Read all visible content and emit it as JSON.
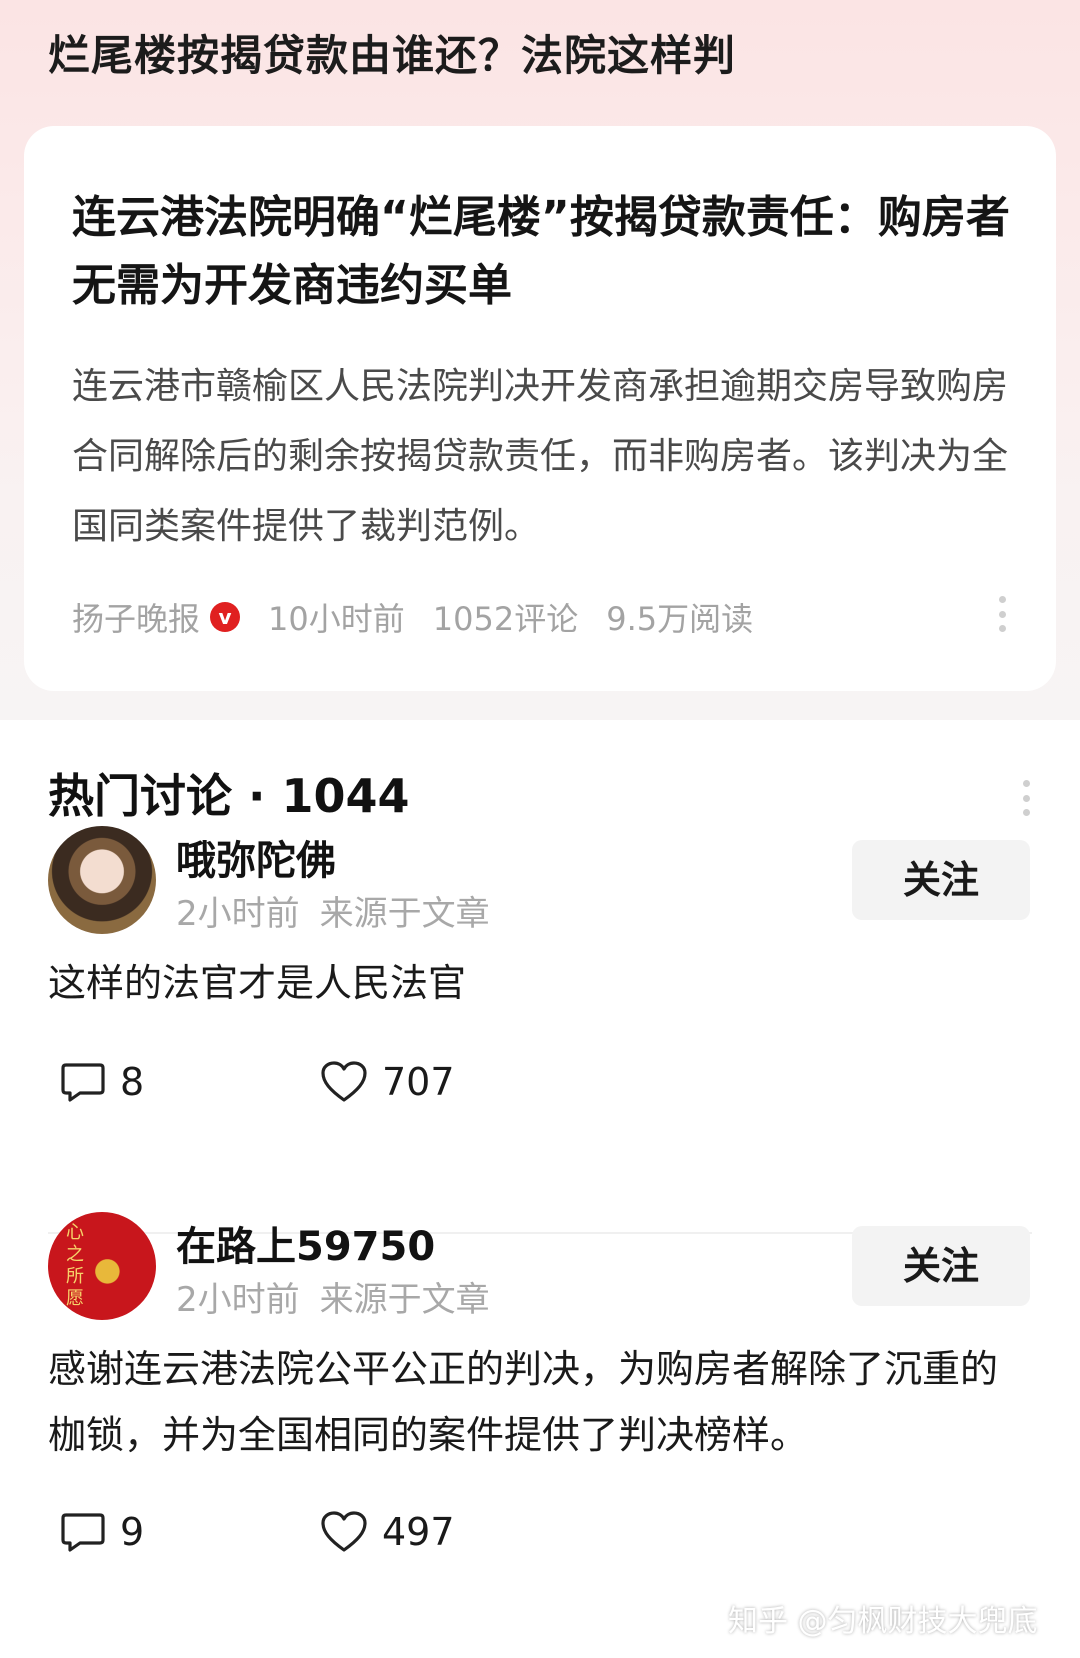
{
  "page": {
    "title": "烂尾楼按揭贷款由谁还？法院这样判"
  },
  "article": {
    "headline": "连云港法院明确“烂尾楼”按揭贷款责任：购房者无需为开发商违约买单",
    "summary": "连云港市赣榆区人民法院判决开发商承担逾期交房导致购房合同解除后的剩余按揭贷款责任，而非购房者。该判决为全国同类案件提供了裁判范例。",
    "source": "扬子晚报",
    "verified_mark": "v",
    "time": "10小时前",
    "comments": "1052评论",
    "reads": "9.5万阅读"
  },
  "discussion": {
    "header": "热门讨论 · 1044"
  },
  "comments": [
    {
      "username": "哦弥陀佛",
      "time": "2小时前",
      "source": "来源于文章",
      "follow_label": "关注",
      "text": "这样的法官才是人民法官",
      "reply_count": "8",
      "like_count": "707"
    },
    {
      "username": "在路上59750",
      "avatar_text": "心之所愿",
      "time": "2小时前",
      "source": "来源于文章",
      "follow_label": "关注",
      "text": "感谢连云港法院公平公正的判决，为购房者解除了沉重的枷锁，并为全国相同的案件提供了判决榜样。",
      "reply_count": "9",
      "like_count": "497"
    }
  ],
  "watermark": "知乎 @匀枫财技大兜底",
  "icons": {
    "verified": "verified-badge-icon",
    "more": "more-vertical-icon",
    "reply": "comment-bubble-icon",
    "like": "heart-icon"
  },
  "colors": {
    "top_background": "#fbe4e4",
    "verified_badge": "#e02020",
    "meta_text": "#a3a3a3",
    "follow_button_bg": "#f3f3f3"
  }
}
